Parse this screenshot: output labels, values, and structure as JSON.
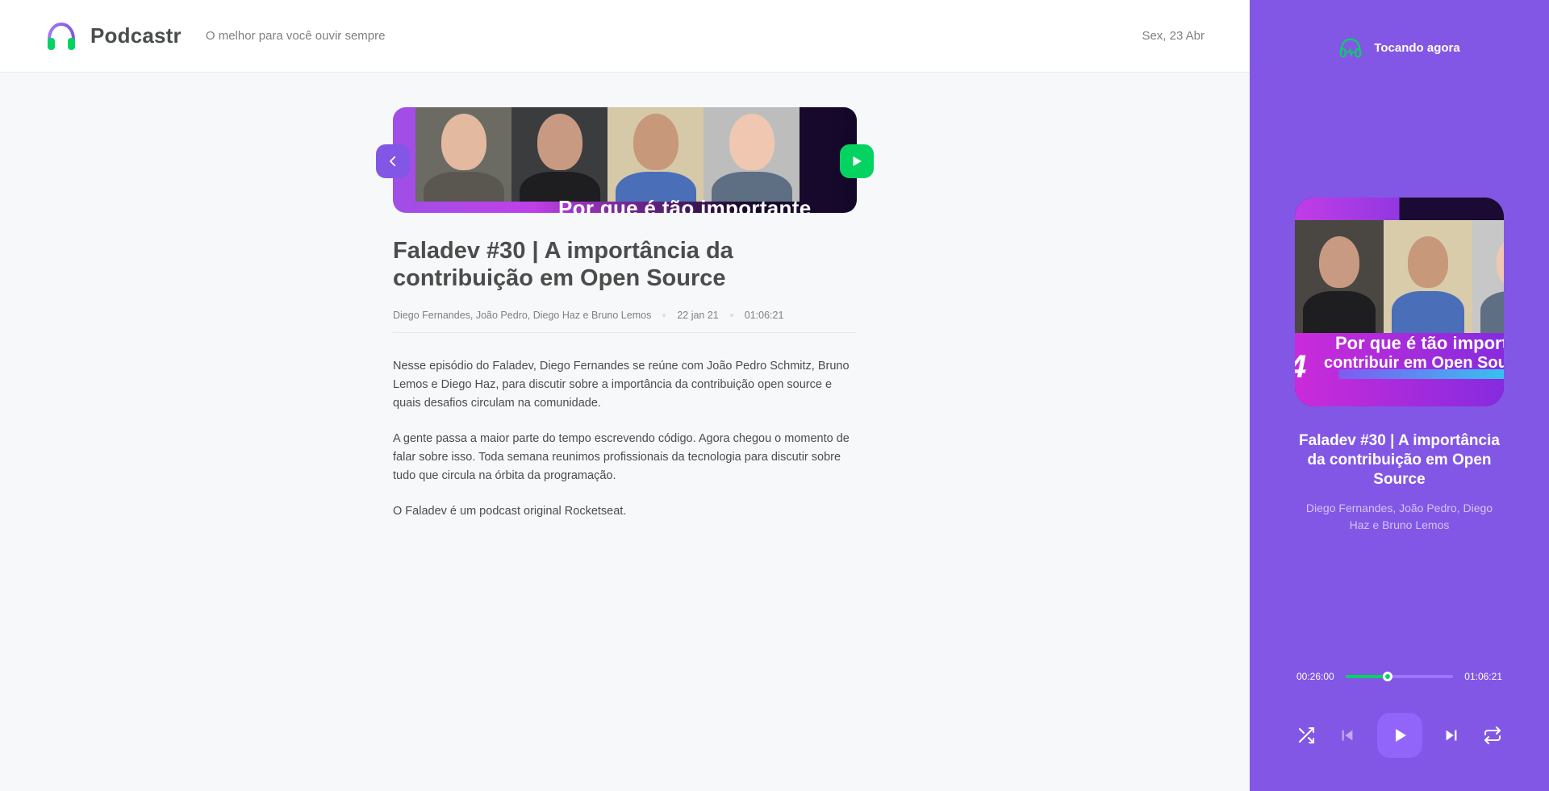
{
  "app": {
    "name": "Podcastr"
  },
  "header": {
    "slogan": "O melhor para você ouvir sempre",
    "date": "Sex, 23 Abr"
  },
  "episode": {
    "thumbnail_caption": "Por que é tão importante",
    "title": "Faladev #30 | A importância da contribuição em Open Source",
    "members": "Diego Fernandes, João Pedro, Diego Haz e Bruno Lemos",
    "published_at": "22 jan 21",
    "duration": "01:06:21",
    "description": [
      "Nesse episódio do Faladev, Diego Fernandes se reúne com João Pedro Schmitz, Bruno Lemos e Diego Haz, para discutir sobre a importância da contribuição open source e quais desafios circulam na comunidade.",
      "A gente passa a maior parte do tempo escrevendo código. Agora chegou o momento de falar sobre isso. Toda semana reunimos profissionais da tecnologia para discutir sobre tudo que circula na órbita da programação.",
      "O Faladev é um podcast original Rocketseat."
    ]
  },
  "player": {
    "header": "Tocando agora",
    "cover_caption_line1": "Por que é tão importante",
    "cover_caption_line2": "contribuir em Open Source",
    "title": "Faladev #30 | A importância da contribuição em Open Source",
    "members": "Diego Fernandes, João Pedro, Diego Haz e Bruno Lemos",
    "current_time": "00:26:00",
    "total_time": "01:06:21",
    "progress": 0.39,
    "controls": [
      "shuffle-icon",
      "previous-icon",
      "play-icon",
      "next-icon",
      "repeat-icon"
    ]
  },
  "colors": {
    "accent_purple": "#8257e5",
    "accent_green": "#04d361",
    "background": "#f7f8fa",
    "text": "#494d4b"
  }
}
